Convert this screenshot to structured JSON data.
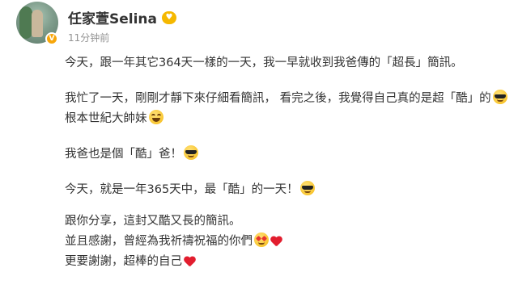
{
  "author": {
    "name": "任家萱Selina",
    "verified_icon": "verified-v-badge",
    "vip_icon": "vip-level-badge"
  },
  "timestamp": "11分钟前",
  "paragraphs": {
    "p1": "今天，跟一年其它364天一樣的一天，我一早就收到我爸傳的「超長」簡訊。",
    "p2a": "我忙了一天，剛剛才靜下來仔細看簡訊， 看完之後，我覺得自己真的是超「酷」的",
    "p2b": "根本世紀大帥妹",
    "p3": "我爸也是個「酷」爸！",
    "p4": "今天，就是一年365天中，最「酷」的一天！",
    "p5a": "跟你分享，這封又酷又長的簡訊。",
    "p5b": "並且感謝，曾經為我祈禱祝福的你們",
    "p5c": "更要謝謝，超棒的自己"
  },
  "emoji_names": {
    "cool": "sunglasses-face-emoji",
    "laugh": "grinning-squinting-face-emoji",
    "love": "smiling-face-with-heart-eyes-emoji",
    "heart": "red-heart-emoji"
  },
  "colors": {
    "text": "#333333",
    "timestamp": "#939393",
    "badge": "#f7a60a",
    "heart": "#e21d2e"
  }
}
